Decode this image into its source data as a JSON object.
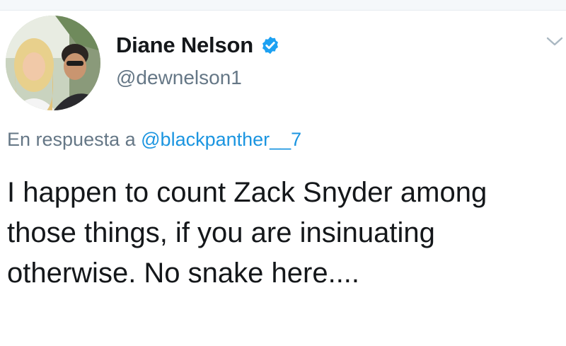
{
  "author": {
    "display_name": "Diane Nelson",
    "handle": "@dewnelson1",
    "verified": true,
    "verified_icon": "verified-badge-icon",
    "verified_color": "#1da1f2"
  },
  "reply": {
    "prefix": "En respuesta a",
    "mention": "@blackpanther__7",
    "mention_color": "#1b95e0"
  },
  "tweet": {
    "text": "I happen to count Zack Snyder among those things, if you are insinuating otherwise. No snake here...."
  },
  "menu": {
    "icon": "chevron-down-icon"
  }
}
